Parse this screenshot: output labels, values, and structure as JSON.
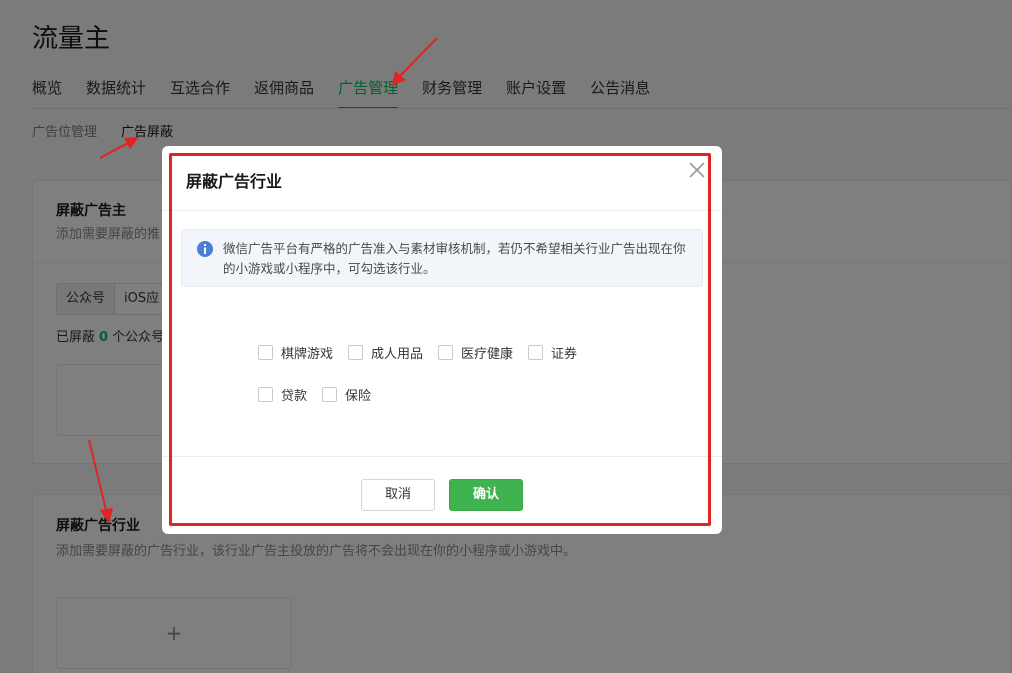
{
  "app": {
    "title": "流量主"
  },
  "main_nav": [
    {
      "label": "概览"
    },
    {
      "label": "数据统计"
    },
    {
      "label": "互选合作"
    },
    {
      "label": "返佣商品"
    },
    {
      "label": "广告管理",
      "active": true
    },
    {
      "label": "财务管理"
    },
    {
      "label": "账户设置"
    },
    {
      "label": "公告消息"
    }
  ],
  "sub_nav": [
    {
      "label": "广告位管理"
    },
    {
      "label": "广告屏蔽",
      "active": true
    }
  ],
  "section_advertiser": {
    "title": "屏蔽广告主",
    "desc": "添加需要屏蔽的推",
    "tabs": [
      "公众号",
      "iOS应"
    ],
    "blocked_prefix": "已屏蔽",
    "blocked_count": "0",
    "blocked_suffix": "个公众号"
  },
  "section_industry": {
    "title": "屏蔽广告行业",
    "desc": "添加需要屏蔽的广告行业，该行业广告主投放的广告将不会出现在你的小程序或小游戏中。",
    "add_symbol": "+"
  },
  "dialog": {
    "title": "屏蔽广告行业",
    "tip": "微信广告平台有严格的广告准入与素材审核机制，若仍不希望相关行业广告出现在你的小游戏或小程序中，可勾选该行业。",
    "options": [
      "棋牌游戏",
      "成人用品",
      "医疗健康",
      "证券",
      "贷款",
      "保险"
    ],
    "cancel_label": "取消",
    "confirm_label": "确认"
  },
  "colors": {
    "accent": "#07c160",
    "confirm": "#3fb34f",
    "annotation": "#e02424",
    "info": "#4a7fd6"
  },
  "icons": {
    "close": "close-icon",
    "info": "info-icon"
  }
}
